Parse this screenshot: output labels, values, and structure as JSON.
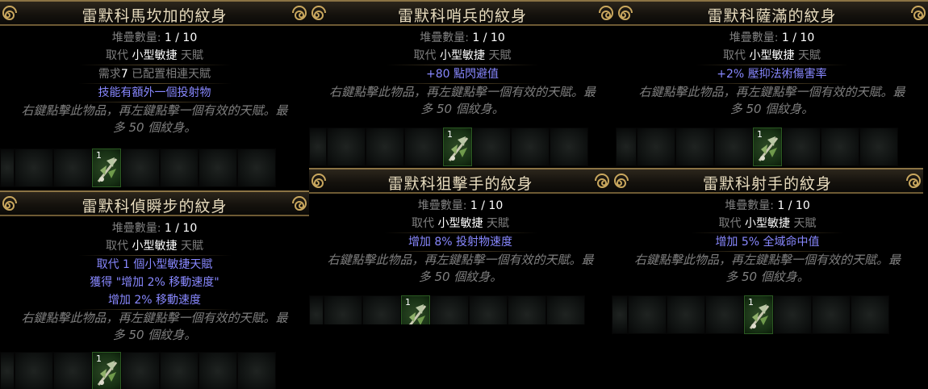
{
  "tattoos": [
    {
      "title": "雷默科馬坎加的紋身",
      "stack_label": "堆疊數量",
      "stack_value": "1 / 10",
      "replace_label": "取代",
      "replace_target": "小型敏捷",
      "replace_suffix": "天賦",
      "requirement_pre": "需求",
      "requirement_num": "7",
      "requirement_post": " 已配置相連天賦",
      "mods": [
        "技能有額外一個投射物"
      ],
      "desc_1": "右鍵點擊此物品，再左鍵點擊一個有效的天賦。最",
      "desc_2": "多 50 個紋身。",
      "item_qty": "1"
    },
    {
      "title": "雷默科哨兵的紋身",
      "stack_label": "堆疊數量",
      "stack_value": "1 / 10",
      "replace_label": "取代",
      "replace_target": "小型敏捷",
      "replace_suffix": "天賦",
      "mods": [
        "+80 點閃避值"
      ],
      "desc_1": "右鍵點擊此物品，再左鍵點擊一個有效的天賦。最",
      "desc_2": "多 50 個紋身。",
      "item_qty": "1"
    },
    {
      "title": "雷默科薩滿的紋身",
      "stack_label": "堆疊數量",
      "stack_value": "1 / 10",
      "replace_label": "取代",
      "replace_target": "小型敏捷",
      "replace_suffix": "天賦",
      "mods": [
        "+2% 壓抑法術傷害率"
      ],
      "desc_1": "右鍵點擊此物品，再左鍵點擊一個有效的天賦。最",
      "desc_2": "多 50 個紋身。",
      "item_qty": "1"
    },
    {
      "title": "雷默科偵瞬步的紋身",
      "stack_label": "堆疊數量",
      "stack_value": "1 / 10",
      "replace_label": "取代",
      "replace_target": "小型敏捷",
      "replace_suffix": "天賦",
      "mods": [
        "取代 1 個小型敏捷天賦",
        "獲得 \"增加 2% 移動速度\"",
        "增加 2% 移動速度"
      ],
      "desc_1": "右鍵點擊此物品，再左鍵點擊一個有效的天賦。最",
      "desc_2": "多 50 個紋身。",
      "item_qty": "1"
    },
    {
      "title": "雷默科狙擊手的紋身",
      "stack_label": "堆疊數量",
      "stack_value": "1 / 10",
      "replace_label": "取代",
      "replace_target": "小型敏捷",
      "replace_suffix": "天賦",
      "mods": [
        "增加 8% 投射物速度"
      ],
      "desc_1": "右鍵點擊此物品，再左鍵點擊一個有效的天賦。最",
      "desc_2": "多 50 個紋身。",
      "item_qty": "1"
    },
    {
      "title": "雷默科射手的紋身",
      "stack_label": "堆疊數量",
      "stack_value": "1 / 10",
      "replace_label": "取代",
      "replace_target": "小型敏捷",
      "replace_suffix": "天賦",
      "mods": [
        "增加 5% 全域命中值"
      ],
      "desc_1": "右鍵點擊此物品，再左鍵點擊一個有效的天賦。最",
      "desc_2": "多 50 個紋身。",
      "item_qty": "1"
    }
  ]
}
